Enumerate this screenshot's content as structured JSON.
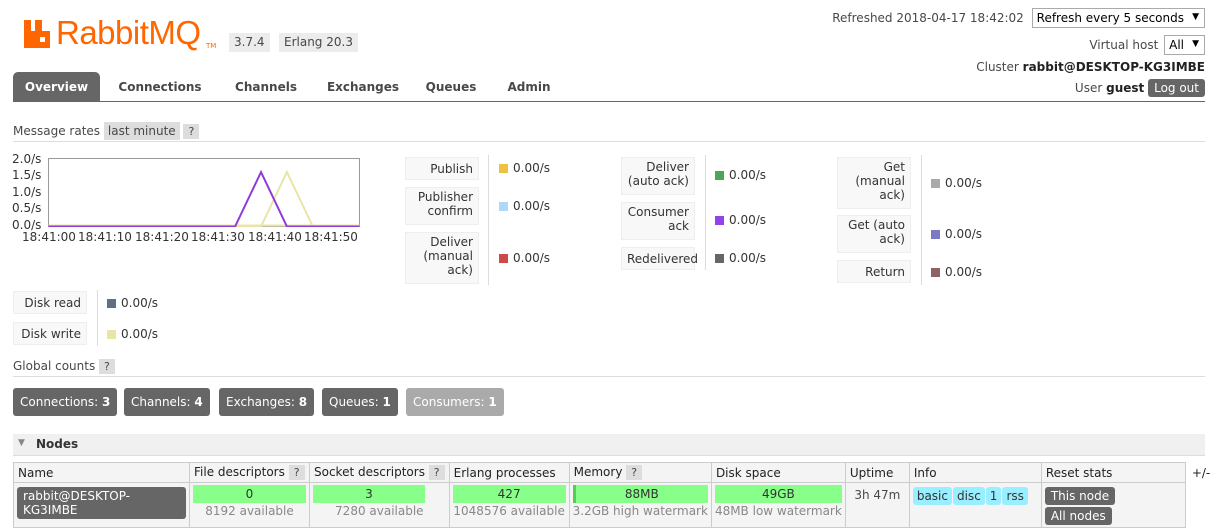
{
  "header": {
    "logo_text": "RabbitMQ",
    "logo_tm": "TM",
    "version": "3.7.4",
    "erlang": "Erlang 20.3",
    "refreshed": "Refreshed 2018-04-17 18:42:02",
    "refresh_select": "Refresh every 5 seconds",
    "vhost_label": "Virtual host",
    "vhost_select": "All",
    "cluster_label": "Cluster",
    "cluster_name": "rabbit@DESKTOP-KG3IMBE",
    "user_label": "User",
    "user_name": "guest",
    "logout": "Log out"
  },
  "tabs": [
    "Overview",
    "Connections",
    "Channels",
    "Exchanges",
    "Queues",
    "Admin"
  ],
  "message_rates": {
    "label": "Message rates",
    "period": "last minute",
    "help": "?"
  },
  "chart_data": {
    "type": "line",
    "y_ticks": [
      "2.0/s",
      "1.5/s",
      "1.0/s",
      "0.5/s",
      "0.0/s"
    ],
    "x_ticks": [
      "18:41:00",
      "18:41:10",
      "18:41:20",
      "18:41:30",
      "18:41:40",
      "18:41:50"
    ],
    "ylim": [
      0,
      2
    ],
    "series": [
      {
        "name": "Deliver (auto ack)",
        "color": "#8f3bd9",
        "x": [
          0,
          36,
          41,
          46,
          60
        ],
        "y": [
          0,
          0,
          1.6,
          0,
          0
        ]
      },
      {
        "name": "Publish",
        "color": "#e8e6a6",
        "x": [
          0,
          41,
          46,
          51,
          60
        ],
        "y": [
          0,
          0,
          1.6,
          0,
          0
        ]
      }
    ]
  },
  "rates": {
    "col1": [
      {
        "label": "Publish",
        "value": "0.00/s",
        "color": "#edc240"
      },
      {
        "label": "Publisher confirm",
        "value": "0.00/s",
        "color": "#afd8f8"
      },
      {
        "label": "Deliver (manual ack)",
        "value": "0.00/s",
        "color": "#cb4b4b"
      }
    ],
    "col2": [
      {
        "label": "Deliver (auto ack)",
        "value": "0.00/s",
        "color": "#4da74d"
      },
      {
        "label": "Consumer ack",
        "value": "0.00/s",
        "color": "#9440ed"
      },
      {
        "label": "Redelivered",
        "value": "0.00/s",
        "color": "#666666"
      }
    ],
    "col3": [
      {
        "label": "Get (manual ack)",
        "value": "0.00/s",
        "color": "#aaaaaa"
      },
      {
        "label": "Get (auto ack)",
        "value": "0.00/s",
        "color": "#7c79c3"
      },
      {
        "label": "Return",
        "value": "0.00/s",
        "color": "#8d6262"
      }
    ],
    "disk": [
      {
        "label": "Disk read",
        "value": "0.00/s",
        "color": "#607080"
      },
      {
        "label": "Disk write",
        "value": "0.00/s",
        "color": "#e8e6a6"
      }
    ]
  },
  "global_counts": {
    "label": "Global counts",
    "help": "?",
    "items": [
      {
        "label": "Connections:",
        "value": "3"
      },
      {
        "label": "Channels:",
        "value": "4"
      },
      {
        "label": "Exchanges:",
        "value": "8"
      },
      {
        "label": "Queues:",
        "value": "1"
      },
      {
        "label": "Consumers:",
        "value": "1"
      }
    ]
  },
  "nodes": {
    "title": "Nodes",
    "plus_minus": "+/-",
    "columns": [
      "Name",
      "File descriptors",
      "Socket descriptors",
      "Erlang processes",
      "Memory",
      "Disk space",
      "Uptime",
      "Info",
      "Reset stats"
    ],
    "row": {
      "name": "rabbit@DESKTOP-KG3IMBE",
      "fd": "0",
      "fd_sub": "8192 available",
      "sd": "3",
      "sd_sub": "7280 available",
      "ep": "427",
      "ep_sub": "1048576 available",
      "mem": "88MB",
      "mem_sub": "3.2GB high watermark",
      "disk": "49GB",
      "disk_sub": "48MB low watermark",
      "uptime": "3h 47m",
      "info": [
        "basic",
        "disc",
        "1",
        "rss"
      ],
      "reset_this": "This node",
      "reset_all": "All nodes"
    }
  }
}
